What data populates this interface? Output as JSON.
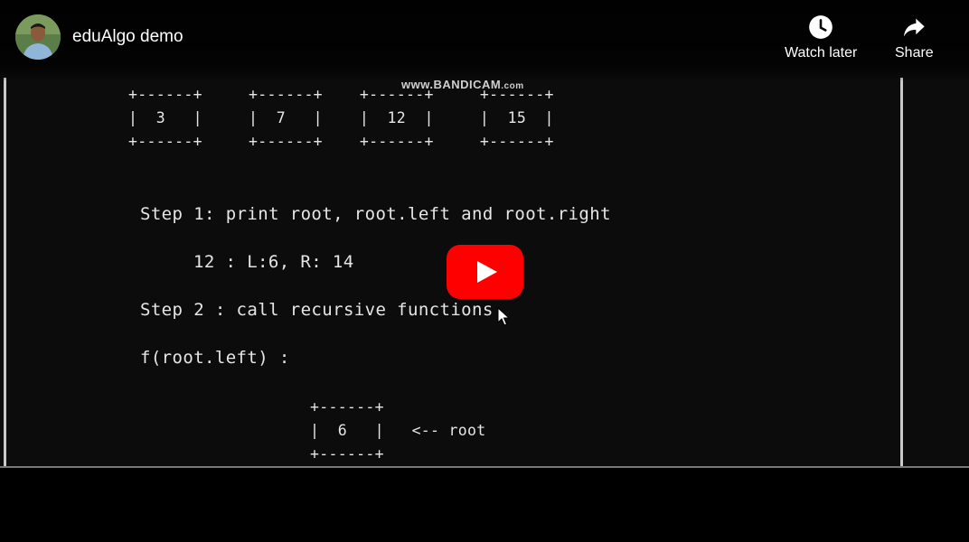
{
  "header": {
    "title": "eduAlgo demo",
    "channel_avatar": "channel-avatar"
  },
  "actions": {
    "watch_later_label": "Watch later",
    "watch_later_icon": "clock-icon",
    "share_label": "Share",
    "share_icon": "share-arrow-icon"
  },
  "player": {
    "play_icon": "play-icon",
    "brand_color": "#ff0000"
  },
  "video": {
    "watermark_main": "www.BANDICAM",
    "watermark_suffix": ".com",
    "tree_top": "+------+     +------+    +------+     +------+\n|  3   |     |  7   |    |  12  |     |  15  |\n+------+     +------+    +------+     +------+",
    "step1": "Step 1: print root, root.left and root.right",
    "step1_detail": "12 : L:6, R: 14",
    "step2": "Step 2 : call recursive functions",
    "call": "f(root.left) :",
    "tree_bottom": "+------+\n|  6   |   <-- root\n+------+"
  }
}
